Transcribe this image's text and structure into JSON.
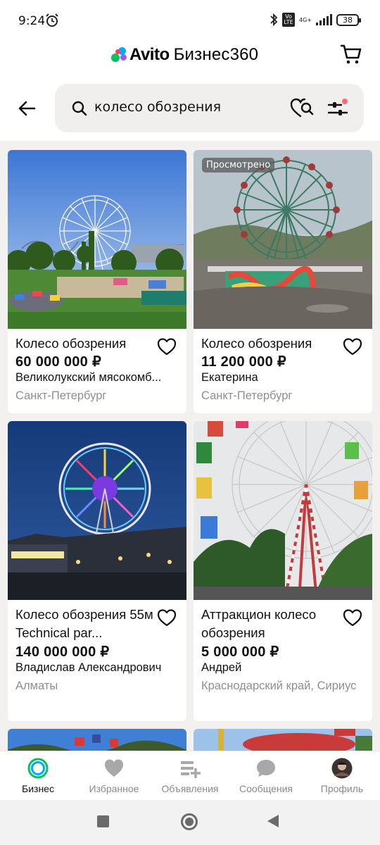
{
  "status_bar": {
    "time": "9:24",
    "network": "4G+",
    "volte": "Vo LTE",
    "battery": "38"
  },
  "header": {
    "brand": "Avito",
    "product": "Бизнес360"
  },
  "search": {
    "query": "колесо обозрения"
  },
  "listings": [
    {
      "title": "Колесо обозрения",
      "price": "60 000 000 ₽",
      "seller": "Великолукский мясокомб...",
      "location": "Санкт-Петербург",
      "badge": ""
    },
    {
      "title": "Колесо обозрения",
      "price": "11 200 000 ₽",
      "seller": "Екатерина",
      "location": "Санкт-Петербург",
      "badge": "Просмотрено"
    },
    {
      "title": "Колесо обозрения 55м Technical par...",
      "price": "140 000 000 ₽",
      "seller": "Владислав Александрович",
      "location": "Алматы",
      "badge": ""
    },
    {
      "title": "Аттракцион колесо обозрения",
      "price": "5 000 000 ₽",
      "seller": "Андрей",
      "location": "Краснодарский край, Сириус",
      "badge": ""
    }
  ],
  "bottom_nav": [
    {
      "label": "Бизнес",
      "icon": "business-ring-icon",
      "active": true
    },
    {
      "label": "Избранное",
      "icon": "heart-icon",
      "active": false
    },
    {
      "label": "Объявления",
      "icon": "listings-add-icon",
      "active": false
    },
    {
      "label": "Сообщения",
      "icon": "chat-bubble-icon",
      "active": false
    },
    {
      "label": "Профиль",
      "icon": "avatar",
      "active": false
    }
  ],
  "colors": {
    "accent_green": "#04c35f",
    "accent_blue": "#00aaff",
    "accent_red": "#ff4053",
    "accent_purple": "#965eeb",
    "notification_dot": "#ff6a6a"
  }
}
